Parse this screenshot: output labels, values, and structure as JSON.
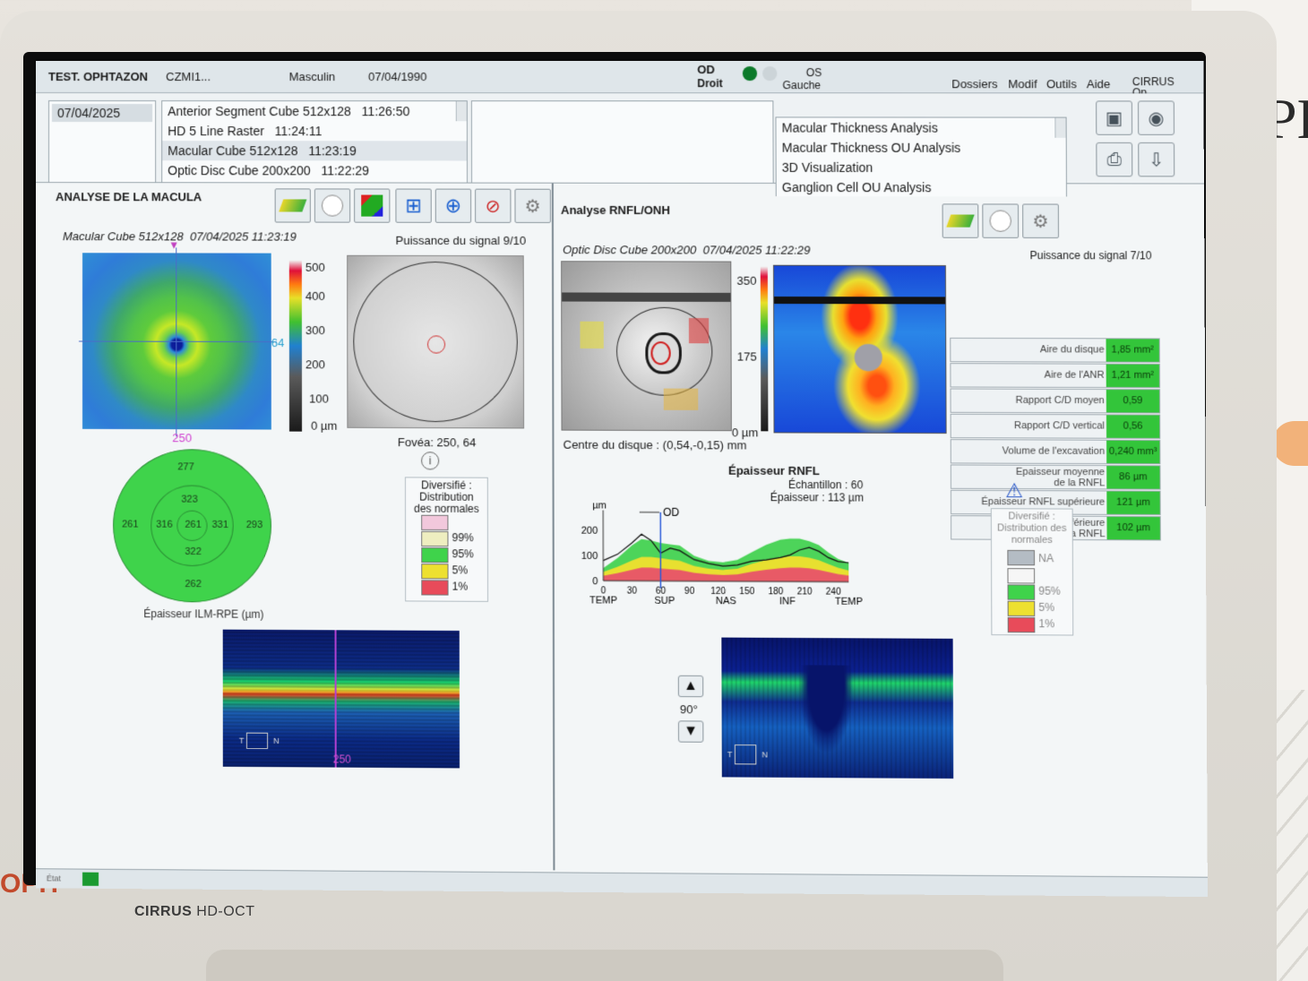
{
  "header": {
    "patient": "TEST. OPHTAZON",
    "id": "CZMI1...",
    "sex": "Masculin",
    "dob": "07/04/1990",
    "od": "OD",
    "od_sub": "Droit",
    "os": "OS",
    "os_sub": "Gauche",
    "menus": [
      "Dossiers",
      "Modif",
      "Outils",
      "Aide"
    ],
    "brand": "CIRRUS",
    "brand_sub": "Op..."
  },
  "scans": {
    "date": "07/04/2025",
    "list": [
      {
        "name": "Anterior Segment Cube 512x128",
        "time": "11:26:50"
      },
      {
        "name": "HD 5 Line Raster",
        "time": "11:24:11"
      },
      {
        "name": "Macular Cube 512x128",
        "time": "11:23:19"
      },
      {
        "name": "Optic Disc Cube 200x200",
        "time": "11:22:29"
      }
    ]
  },
  "analyses": [
    "Macular Thickness Analysis",
    "Macular Thickness OU Analysis",
    "3D Visualization",
    "Ganglion Cell OU Analysis"
  ],
  "macula": {
    "title": "ANALYSE DE LA MACULA",
    "scan": "Macular Cube 512x128",
    "scan_date": "07/04/2025 11:23:19",
    "signal": "Puissance du signal 9/10",
    "scale": [
      "500",
      "400",
      "300",
      "200",
      "100",
      "0 µm"
    ],
    "map_h": "250",
    "map_v": "64",
    "fovea": "Fovéa: 250, 64",
    "etdrs": {
      "outer_sup": "277",
      "inner_sup": "323",
      "outer_nas": "261",
      "inner_nas": "316",
      "center": "261",
      "inner_temp": "331",
      "outer_temp": "293",
      "inner_inf": "322",
      "outer_inf": "262"
    },
    "etdrs_label": "Épaisseur ILM-RPE (µm)",
    "legend_title": "Diversifié : Distribution des normales",
    "legend": [
      "99%",
      "95%",
      "5%",
      "1%"
    ],
    "bscan_label": "250",
    "bscan_t": "T",
    "bscan_n": "N"
  },
  "rnfl": {
    "title": "Analyse RNFL/ONH",
    "scan": "Optic Disc Cube 200x200",
    "scan_date": "07/04/2025 11:22:29",
    "signal": "Puissance du signal 7/10",
    "scale": [
      "350",
      "175",
      "0 µm"
    ],
    "disc_center": "Centre du disque : (0,54,-0,15) mm",
    "table": [
      {
        "label": "Aire du disque",
        "value": "1,85 mm²"
      },
      {
        "label": "Aire de l'ANR",
        "value": "1,21 mm²"
      },
      {
        "label": "Rapport C/D moyen",
        "value": "0,59"
      },
      {
        "label": "Rapport C/D vertical",
        "value": "0,56"
      },
      {
        "label": "Volume de l'excavation",
        "value": "0,240 mm³"
      },
      {
        "label": "Epaisseur moyenne de la RNFL",
        "value": "86 µm"
      },
      {
        "label": "Épaisseur RNFL supérieure",
        "value": "121 µm"
      },
      {
        "label": "Épaisseur inférieure de la RNFL",
        "value": "102 µm"
      }
    ],
    "chart_title": "Épaisseur RNFL",
    "sample": "Échantillon : 60",
    "thickness": "Épaisseur : 113 µm",
    "legend_title": "Diversifié : Distribution des normales",
    "legend": [
      "NA",
      "95%",
      "5%",
      "1%"
    ],
    "angle": "90°",
    "bscan_t": "T",
    "bscan_n": "N"
  },
  "chart_data": {
    "type": "area",
    "title": "Épaisseur RNFL",
    "ylabel": "µm",
    "ylim": [
      0,
      250
    ],
    "xlim": [
      0,
      256
    ],
    "x_ticks": [
      0,
      30,
      60,
      90,
      120,
      150,
      180,
      210,
      240
    ],
    "sector_labels": [
      {
        "label": "TEMP",
        "x": 0
      },
      {
        "label": "SUP",
        "x": 64
      },
      {
        "label": "NAS",
        "x": 128
      },
      {
        "label": "INF",
        "x": 192
      },
      {
        "label": "TEMP",
        "x": 256
      }
    ],
    "y_ticks": [
      0,
      100,
      200
    ],
    "cursor_x": 60,
    "series": [
      {
        "name": "OD",
        "x": [
          0,
          15,
          30,
          40,
          50,
          60,
          70,
          80,
          95,
          110,
          125,
          140,
          155,
          170,
          185,
          195,
          205,
          215,
          225,
          235,
          245,
          256
        ],
        "values": [
          80,
          105,
          150,
          185,
          160,
          110,
          130,
          120,
          85,
          70,
          60,
          65,
          80,
          85,
          95,
          105,
          125,
          135,
          120,
          95,
          80,
          75
        ]
      },
      {
        "name": "",
        "x": [
          0,
          15,
          30,
          40,
          50,
          60,
          70,
          80,
          95,
          110,
          125,
          140,
          155,
          170,
          185,
          195,
          205,
          215,
          225,
          235,
          245,
          256
        ],
        "values": [
          50,
          90,
          140,
          165,
          160,
          150,
          145,
          140,
          100,
          80,
          75,
          85,
          115,
          145,
          165,
          170,
          170,
          160,
          145,
          115,
          90,
          75
        ]
      },
      {
        "name": "",
        "x": [
          0,
          15,
          30,
          40,
          50,
          60,
          70,
          80,
          95,
          110,
          125,
          140,
          155,
          170,
          185,
          195,
          205,
          215,
          225,
          235,
          245,
          256
        ],
        "values": [
          35,
          55,
          80,
          95,
          95,
          90,
          85,
          80,
          60,
          50,
          45,
          50,
          70,
          85,
          95,
          100,
          100,
          95,
          85,
          70,
          55,
          45
        ]
      }
    ]
  },
  "status": {
    "state": "État"
  },
  "monitor": {
    "brand": "CIRRUS",
    "model": "HD-OCT"
  },
  "bg": {
    "logo": "PH",
    "left": "OPH"
  }
}
